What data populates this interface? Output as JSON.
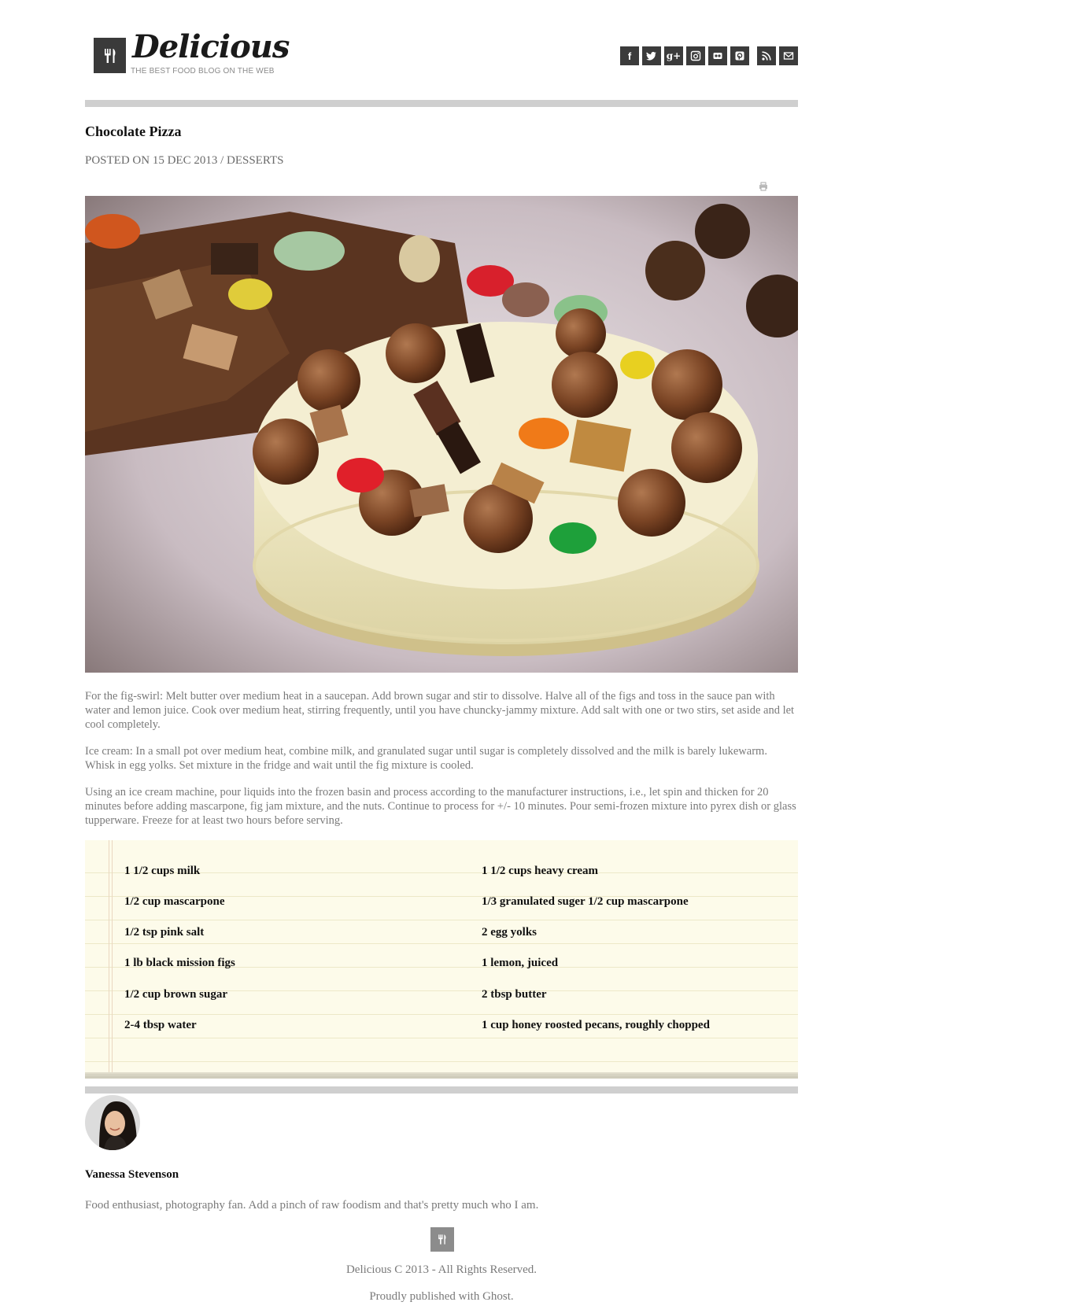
{
  "site": {
    "name": "Delicious",
    "tagline": "THE BEST FOOD BLOG ON THE WEB",
    "logo_icon": "fork-knife-icon"
  },
  "social": [
    {
      "name": "facebook",
      "glyph": "f"
    },
    {
      "name": "twitter",
      "glyph": "t"
    },
    {
      "name": "google-plus",
      "glyph": "g+"
    },
    {
      "name": "instagram",
      "glyph": ""
    },
    {
      "name": "flickr",
      "glyph": ""
    },
    {
      "name": "pinterest",
      "glyph": ""
    },
    {
      "name": "rss",
      "glyph": ""
    },
    {
      "name": "email",
      "glyph": ""
    }
  ],
  "post": {
    "title": "Chocolate Pizza",
    "meta": "POSTED ON 15 DEC 2013 / DESSERTS",
    "paragraphs": [
      "For the fig-swirl: Melt butter over medium heat in a saucepan. Add brown sugar and stir to dissolve. Halve all of the figs and toss in the sauce pan with water and lemon juice. Cook over medium heat, stirring frequently, until you have chuncky-jammy mixture. Add salt with one or two stirs, set aside and let cool completely.",
      "Ice cream: In a small pot over medium heat, combine milk, and granulated sugar until sugar is completely dissolved and the milk is barely lukewarm. Whisk in egg yolks. Set mixture in the fridge and wait until the fig mixture is cooled.",
      "Using an ice cream machine, pour liquids into the frozen basin and process according to the manufacturer instructions, i.e., let spin and thicken for 20 minutes before adding mascarpone, fig jam mixture, and the nuts. Continue to process for +/- 10 minutes. Pour semi-frozen mixture into pyrex dish or glass tupperware. Freeze for at least two hours before serving."
    ],
    "ingredients_left": [
      "1 1/2 cups milk",
      "1/2 cup mascarpone",
      "1/2 tsp pink salt",
      "1 lb black mission figs",
      "1/2 cup brown sugar",
      "2-4 tbsp water"
    ],
    "ingredients_right": [
      "1 1/2 cups heavy cream",
      "1/3 granulated suger 1/2 cup mascarpone",
      "2 egg yolks",
      "1 lemon, juiced",
      "2 tbsp butter",
      "1 cup honey roosted pecans, roughly chopped"
    ]
  },
  "author": {
    "name": "Vanessa Stevenson",
    "bio": "Food enthusiast, photography fan. Add a pinch of raw foodism and that's pretty much who I am."
  },
  "footer": {
    "copyright": "Delicious C 2013 - All Rights Reserved.",
    "published": "Proudly published with Ghost."
  }
}
